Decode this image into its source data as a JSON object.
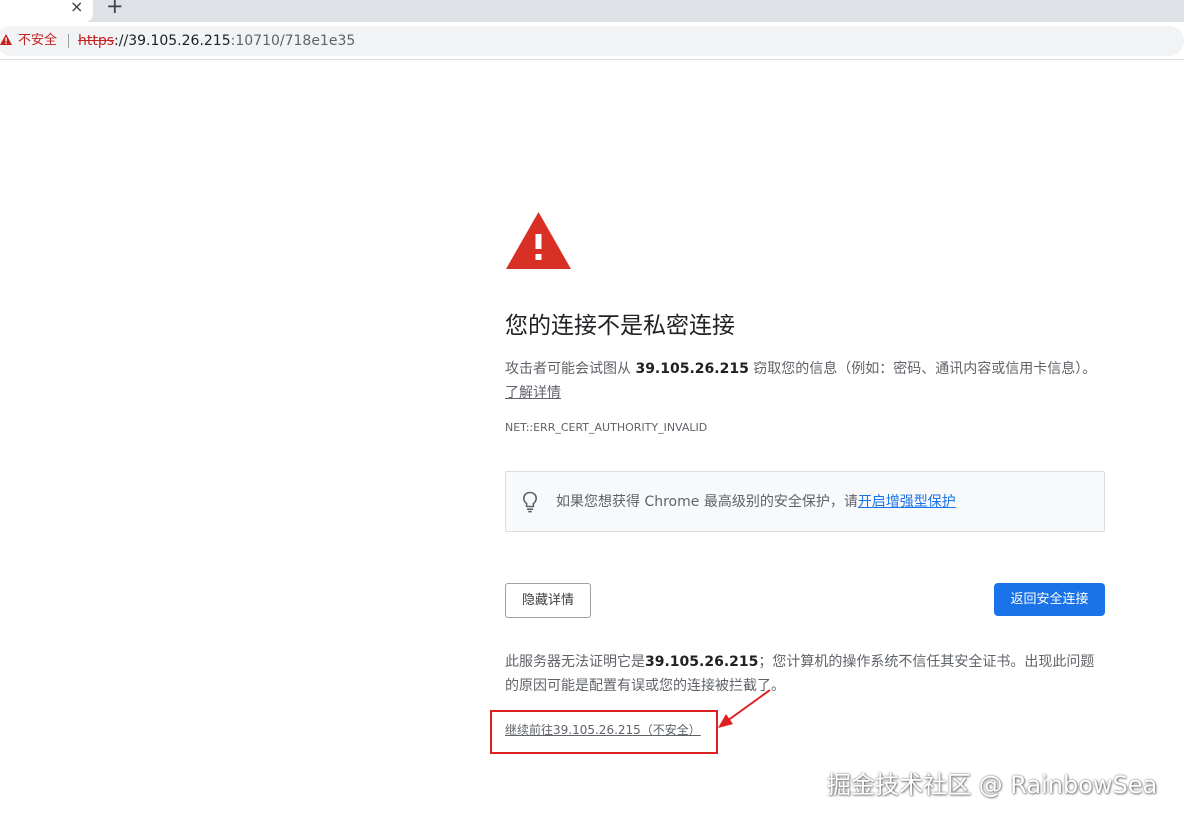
{
  "browser": {
    "tab": {
      "close_glyph": "×"
    },
    "new_tab_glyph": "+",
    "omnibox": {
      "security_label": "不安全",
      "url_scheme": "https",
      "url_host": "://39.105.26.215",
      "url_rest": ":10710/718e1e35"
    }
  },
  "interstitial": {
    "title": "您的连接不是私密连接",
    "description_prefix": "攻击者可能会试图从 ",
    "description_host": "39.105.26.215",
    "description_suffix": " 窃取您的信息（例如：密码、通讯内容或信用卡信息）。",
    "learn_more": "了解详情",
    "error_code": "NET::ERR_CERT_AUTHORITY_INVALID",
    "promo_text": "如果您想获得 Chrome 最高级别的安全保护，请",
    "promo_link": "开启增强型保护",
    "details_button": "隐藏详情",
    "back_button": "返回安全连接",
    "detail_prefix": "此服务器无法证明它是",
    "detail_host": "39.105.26.215",
    "detail_suffix": "；您计算机的操作系统不信任其安全证书。出现此问题的原因可能是配置有误或您的连接被拦截了。",
    "proceed_link": "继续前往39.105.26.215（不安全）"
  },
  "watermark": "掘金技术社区 @ RainbowSea",
  "colors": {
    "warning_red": "#d93025",
    "link_blue": "#1a73e8",
    "annotation_red": "#e02020"
  },
  "icons": {
    "omnibox_warning": "warning-triangle-icon",
    "page_warning": "large-warning-triangle-icon",
    "promo": "lightbulb-icon"
  }
}
